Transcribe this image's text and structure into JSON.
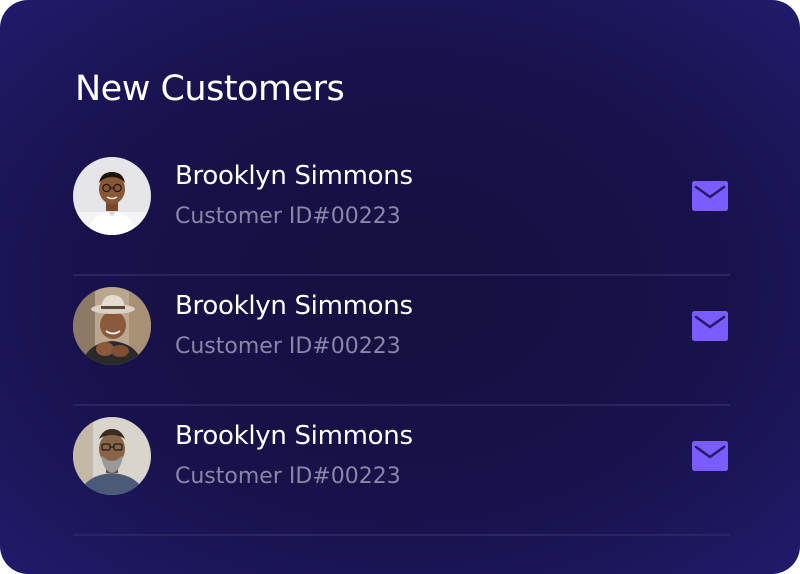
{
  "card": {
    "title": "New Customers"
  },
  "customers": [
    {
      "name": "Brooklyn Simmons",
      "customer_id": "Customer ID#00223",
      "avatar": "avatar-photo-man-glasses",
      "action_icon": "mail-icon"
    },
    {
      "name": "Brooklyn Simmons",
      "customer_id": "Customer ID#00223",
      "avatar": "avatar-photo-man-hat",
      "action_icon": "mail-icon"
    },
    {
      "name": "Brooklyn Simmons",
      "customer_id": "Customer ID#00223",
      "avatar": "avatar-photo-man-beard",
      "action_icon": "mail-icon"
    }
  ],
  "colors": {
    "background": "#17124a",
    "accent": "#7b5cff",
    "secondary_text": "#8a86a8",
    "divider": "#2b2560"
  }
}
